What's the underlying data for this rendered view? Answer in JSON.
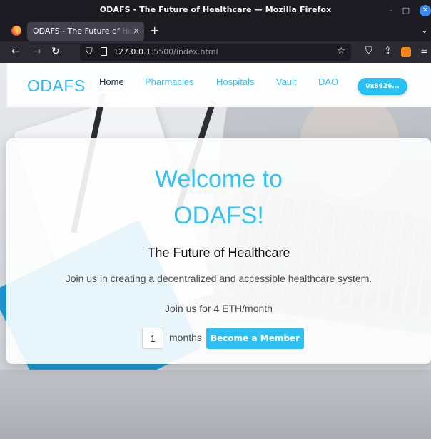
{
  "window": {
    "title": "ODAFS - The Future of Healthcare — Mozilla Firefox",
    "minimize_glyph": "–",
    "maximize_glyph": "□",
    "close_glyph": "✕"
  },
  "tabs": [
    {
      "label": "ODAFS - The Future of Healthcare",
      "close_glyph": "×"
    }
  ],
  "tabbar": {
    "new_tab_glyph": "+",
    "list_glyph": "⌄"
  },
  "toolbar": {
    "back_glyph": "←",
    "forward_glyph": "→",
    "reload_glyph": "↻",
    "url_host": "127.0.0.1",
    "url_rest": ":5500/index.html",
    "bookmark_glyph": "☆",
    "pocket_glyph": "⛉",
    "share_glyph": "⇪",
    "menu_glyph": "≡"
  },
  "site_nav": {
    "brand": "ODAFS",
    "links": [
      {
        "label": "Home",
        "active": true
      },
      {
        "label": "Pharmacies",
        "active": false
      },
      {
        "label": "Hospitals",
        "active": false
      },
      {
        "label": "Vault",
        "active": false
      },
      {
        "label": "DAO",
        "active": false
      }
    ],
    "wallet_label": "0x8626..."
  },
  "hero": {
    "heading_line1": "Welcome to",
    "heading_line2": "ODAFS!",
    "subtitle": "The Future of Healthcare",
    "lead": "Join us in creating a decentralized and accessible healthcare system.",
    "price_text": "Join us for 4 ETH/month",
    "months_value": "1",
    "months_label": "months",
    "member_button": "Become a Member"
  },
  "colors": {
    "accent": "#29b6f6",
    "button": "#2fc1f3",
    "active_nav": "#1f2a44"
  }
}
